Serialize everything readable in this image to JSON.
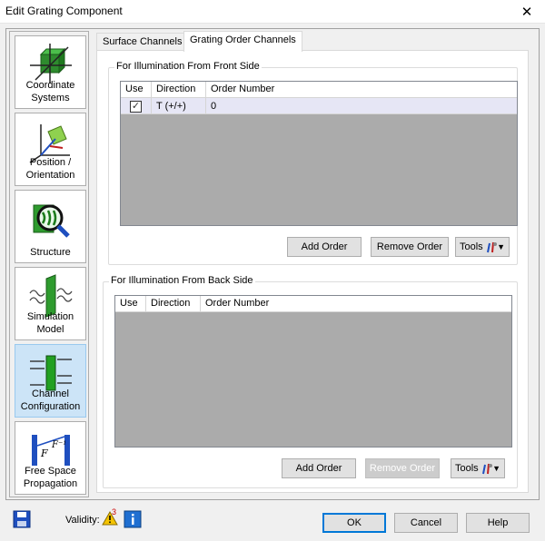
{
  "window": {
    "title": "Edit Grating Component",
    "close_glyph": "✕"
  },
  "sidebar": {
    "items": [
      {
        "label_line1": "Coordinate",
        "label_line2": "Systems",
        "icon": "coordinate-systems-icon"
      },
      {
        "label_line1": "Position /",
        "label_line2": "Orientation",
        "icon": "position-orientation-icon"
      },
      {
        "label_line1": "",
        "label_line2": "Structure",
        "icon": "structure-icon"
      },
      {
        "label_line1": "Simulation",
        "label_line2": "Model",
        "icon": "simulation-model-icon"
      },
      {
        "label_line1": "Channel",
        "label_line2": "Configuration",
        "icon": "channel-configuration-icon",
        "active": true
      },
      {
        "label_line1": "Free Space",
        "label_line2": "Propagation",
        "icon": "free-space-propagation-icon"
      }
    ]
  },
  "tabs": [
    {
      "label": "Surface Channels"
    },
    {
      "label": "Grating Order Channels",
      "active": true
    }
  ],
  "front": {
    "legend": "For Illumination From Front Side",
    "columns": [
      "Use",
      "Direction",
      "Order Number"
    ],
    "rows": [
      {
        "use": true,
        "use_glyph": "✓",
        "direction": "T (+/+)",
        "order": "0"
      }
    ],
    "add_label": "Add Order",
    "remove_label": "Remove Order",
    "tools_label": "Tools"
  },
  "back": {
    "legend": "For Illumination From Back Side",
    "columns": [
      "Use",
      "Direction",
      "Order Number"
    ],
    "rows": [],
    "add_label": "Add Order",
    "remove_label": "Remove Order",
    "tools_label": "Tools"
  },
  "footer": {
    "validity_label": "Validity:",
    "warning_count": "3",
    "ok_label": "OK",
    "cancel_label": "Cancel",
    "help_label": "Help"
  }
}
